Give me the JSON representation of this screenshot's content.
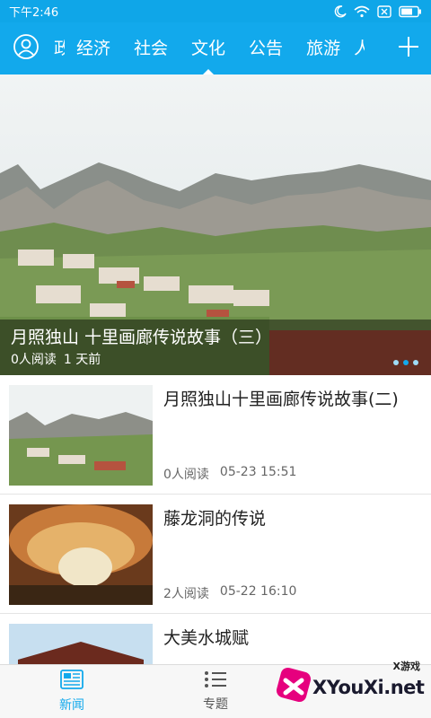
{
  "status_bar": {
    "time": "下午2:46",
    "battery_icon": "battery-icon",
    "wifi_icon": "wifi-icon",
    "moon_icon": "moon-icon"
  },
  "nav": {
    "tabs": [
      {
        "label": "政",
        "partial": true
      },
      {
        "label": "经济"
      },
      {
        "label": "社会"
      },
      {
        "label": "文化",
        "active": true
      },
      {
        "label": "公告"
      },
      {
        "label": "旅游"
      },
      {
        "label": "人",
        "partial": true
      }
    ],
    "accent": "#12a9ec"
  },
  "hero": {
    "title": "月照独山 十里画廊传说故事（三）",
    "reads": "0人阅读",
    "time": "1 天前"
  },
  "news": [
    {
      "title": "月照独山十里画廊传说故事(二)",
      "reads": "0人阅读",
      "time": "05-23 15:51"
    },
    {
      "title": "藤龙洞的传说",
      "reads": "2人阅读",
      "time": "05-22 16:10"
    },
    {
      "title": "大美水城赋",
      "reads": "",
      "time": ""
    }
  ],
  "bottom_nav": [
    {
      "label": "新闻",
      "icon": "news-icon",
      "active": true
    },
    {
      "label": "专题",
      "icon": "list-icon"
    }
  ],
  "watermark": {
    "text": "XYouXi.net",
    "small": "X游戏"
  }
}
